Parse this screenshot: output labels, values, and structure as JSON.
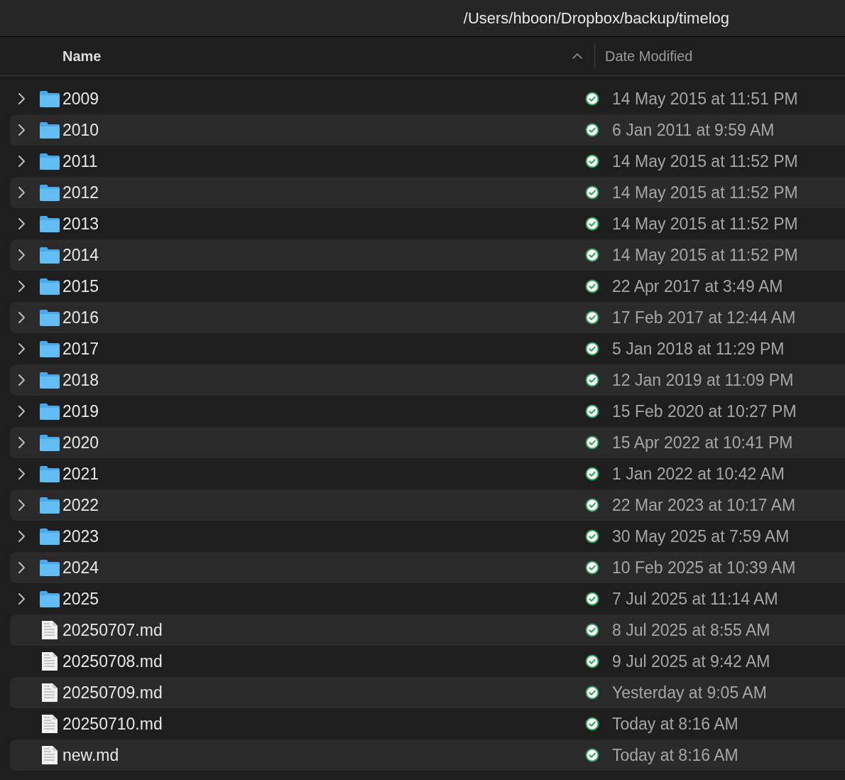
{
  "window": {
    "title": "/Users/hboon/Dropbox/backup/timelog"
  },
  "table": {
    "columns": [
      "Name",
      "Date Modified"
    ],
    "rows": [
      {
        "kind": "folder",
        "name": "2009",
        "modified": "14 May 2015 at 11:51 PM"
      },
      {
        "kind": "folder",
        "name": "2010",
        "modified": "6 Jan 2011 at 9:59 AM"
      },
      {
        "kind": "folder",
        "name": "2011",
        "modified": "14 May 2015 at 11:52 PM"
      },
      {
        "kind": "folder",
        "name": "2012",
        "modified": "14 May 2015 at 11:52 PM"
      },
      {
        "kind": "folder",
        "name": "2013",
        "modified": "14 May 2015 at 11:52 PM"
      },
      {
        "kind": "folder",
        "name": "2014",
        "modified": "14 May 2015 at 11:52 PM"
      },
      {
        "kind": "folder",
        "name": "2015",
        "modified": "22 Apr 2017 at 3:49 AM"
      },
      {
        "kind": "folder",
        "name": "2016",
        "modified": "17 Feb 2017 at 12:44 AM"
      },
      {
        "kind": "folder",
        "name": "2017",
        "modified": "5 Jan 2018 at 11:29 PM"
      },
      {
        "kind": "folder",
        "name": "2018",
        "modified": "12 Jan 2019 at 11:09 PM"
      },
      {
        "kind": "folder",
        "name": "2019",
        "modified": "15 Feb 2020 at 10:27 PM"
      },
      {
        "kind": "folder",
        "name": "2020",
        "modified": "15 Apr 2022 at 10:41 PM"
      },
      {
        "kind": "folder",
        "name": "2021",
        "modified": "1 Jan 2022 at 10:42 AM"
      },
      {
        "kind": "folder",
        "name": "2022",
        "modified": "22 Mar 2023 at 10:17 AM"
      },
      {
        "kind": "folder",
        "name": "2023",
        "modified": "30 May 2025 at 7:59 AM"
      },
      {
        "kind": "folder",
        "name": "2024",
        "modified": "10 Feb 2025 at 10:39 AM"
      },
      {
        "kind": "folder",
        "name": "2025",
        "modified": "7 Jul 2025 at 11:14 AM"
      },
      {
        "kind": "file",
        "name": "20250707.md",
        "modified": "8 Jul 2025 at 8:55 AM"
      },
      {
        "kind": "file",
        "name": "20250708.md",
        "modified": "9 Jul 2025 at 9:42 AM"
      },
      {
        "kind": "file",
        "name": "20250709.md",
        "modified": "Yesterday at 9:05 AM"
      },
      {
        "kind": "file",
        "name": "20250710.md",
        "modified": "Today at 8:16 AM"
      },
      {
        "kind": "file",
        "name": "new.md",
        "modified": "Today at 8:16 AM"
      }
    ]
  }
}
